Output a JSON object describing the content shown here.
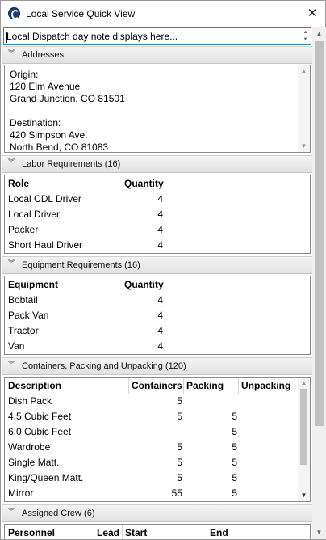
{
  "window": {
    "title": "Local Service Quick View",
    "close_label": "✕"
  },
  "dispatch_note": {
    "text": "Local Dispatch day note displays here..."
  },
  "sections": {
    "addresses": {
      "title": "Addresses",
      "text": "Origin:\n120 Elm Avenue\nGrand Junction, CO 81501\n\nDestination:\n420 Simpson Ave.\nNorth Bend, CO 81083"
    },
    "labor": {
      "title": "Labor Requirements (16)",
      "col_role": "Role",
      "col_quantity": "Quantity",
      "rows": [
        {
          "role": "Local CDL Driver",
          "qty": "4"
        },
        {
          "role": "Local Driver",
          "qty": "4"
        },
        {
          "role": "Packer",
          "qty": "4"
        },
        {
          "role": "Short Haul Driver",
          "qty": "4"
        }
      ]
    },
    "equipment": {
      "title": "Equipment Requirements (16)",
      "col_equipment": "Equipment",
      "col_quantity": "Quantity",
      "rows": [
        {
          "name": "Bobtail",
          "qty": "4"
        },
        {
          "name": "Pack Van",
          "qty": "4"
        },
        {
          "name": "Tractor",
          "qty": "4"
        },
        {
          "name": "Van",
          "qty": "4"
        }
      ]
    },
    "containers": {
      "title": "Containers, Packing and Unpacking (120)",
      "col_description": "Description",
      "col_containers": "Containers",
      "col_packing": "Packing",
      "col_unpacking": "Unpacking",
      "rows": [
        {
          "desc": "Dish Pack",
          "containers": "5",
          "packing": "",
          "unpacking": ""
        },
        {
          "desc": "4.5 Cubic Feet",
          "containers": "5",
          "packing": "5",
          "unpacking": ""
        },
        {
          "desc": "6.0 Cubic Feet",
          "containers": "",
          "packing": "5",
          "unpacking": ""
        },
        {
          "desc": "Wardrobe",
          "containers": "5",
          "packing": "5",
          "unpacking": ""
        },
        {
          "desc": "Single Matt.",
          "containers": "5",
          "packing": "5",
          "unpacking": ""
        },
        {
          "desc": "King/Queen Matt.",
          "containers": "5",
          "packing": "5",
          "unpacking": ""
        },
        {
          "desc": "Mirror",
          "containers": "55",
          "packing": "5",
          "unpacking": ""
        }
      ]
    },
    "crew": {
      "title": "Assigned Crew (6)",
      "col_personnel": "Personnel",
      "col_lead": "Lead",
      "col_start": "Start",
      "col_end": "End"
    }
  },
  "colors": {
    "focus_border": "#3c7fb1",
    "header_bg": "#e8e8e8"
  }
}
